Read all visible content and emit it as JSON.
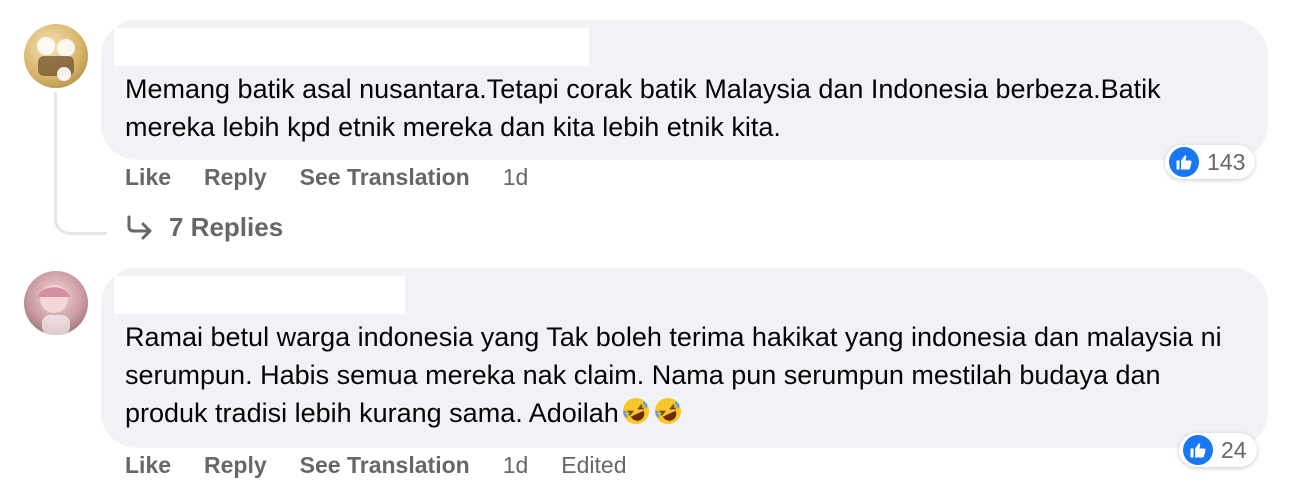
{
  "comments": [
    {
      "text": "Memang batik asal nusantara.Tetapi corak batik Malaysia dan Indonesia berbeza.Batik mereka lebih kpd etnik mereka dan kita lebih etnik kita.",
      "actions": {
        "like": "Like",
        "reply": "Reply",
        "translate": "See Translation",
        "time": "1d"
      },
      "reaction_count": "143",
      "replies_label": "7 Replies"
    },
    {
      "text": "Ramai betul warga indonesia yang Tak boleh terima hakikat yang indonesia dan malaysia ni serumpun. Habis semua mereka nak claim. Nama pun serumpun mestilah budaya dan produk tradisi lebih kurang sama. Adoilah",
      "emojis": [
        "rolling-on-floor-laughing",
        "rolling-on-floor-laughing"
      ],
      "actions": {
        "like": "Like",
        "reply": "Reply",
        "translate": "See Translation",
        "time": "1d",
        "edited": "Edited"
      },
      "reaction_count": "24"
    }
  ],
  "colors": {
    "bubble": "#f0f2f5",
    "secondary_text": "#65676b",
    "like_blue": "#1877f2"
  }
}
